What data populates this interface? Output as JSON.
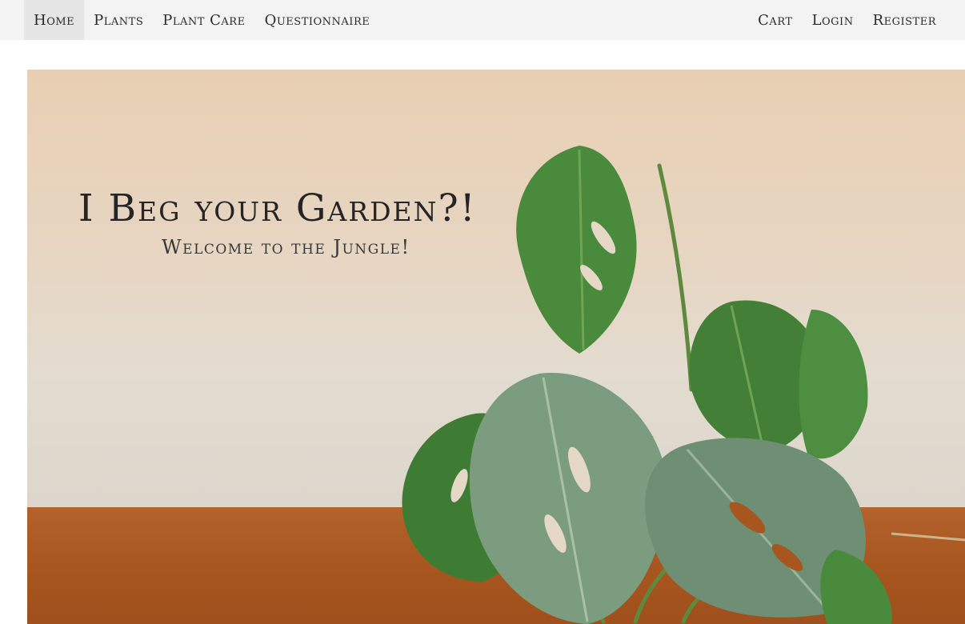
{
  "nav": {
    "left_items": [
      {
        "label": "Home",
        "active": true
      },
      {
        "label": "Plants",
        "active": false
      },
      {
        "label": "Plant Care",
        "active": false
      },
      {
        "label": "Questionnaire",
        "active": false
      }
    ],
    "right_items": [
      {
        "label": "Cart"
      },
      {
        "label": "Login"
      },
      {
        "label": "Register"
      }
    ]
  },
  "hero": {
    "title": "I Beg your Garden?!",
    "subtitle": "Welcome to the Jungle!",
    "image_icon": "monstera-plant-illustration"
  },
  "colors": {
    "navbar_bg": "#f3f3f3",
    "nav_active_bg": "#e5e5e5",
    "text": "#2b2b2b",
    "wall": "#e7d6c3",
    "shelf": "#a8561f",
    "leaf_dark": "#3f7a35",
    "leaf_light": "#7e9c80"
  }
}
